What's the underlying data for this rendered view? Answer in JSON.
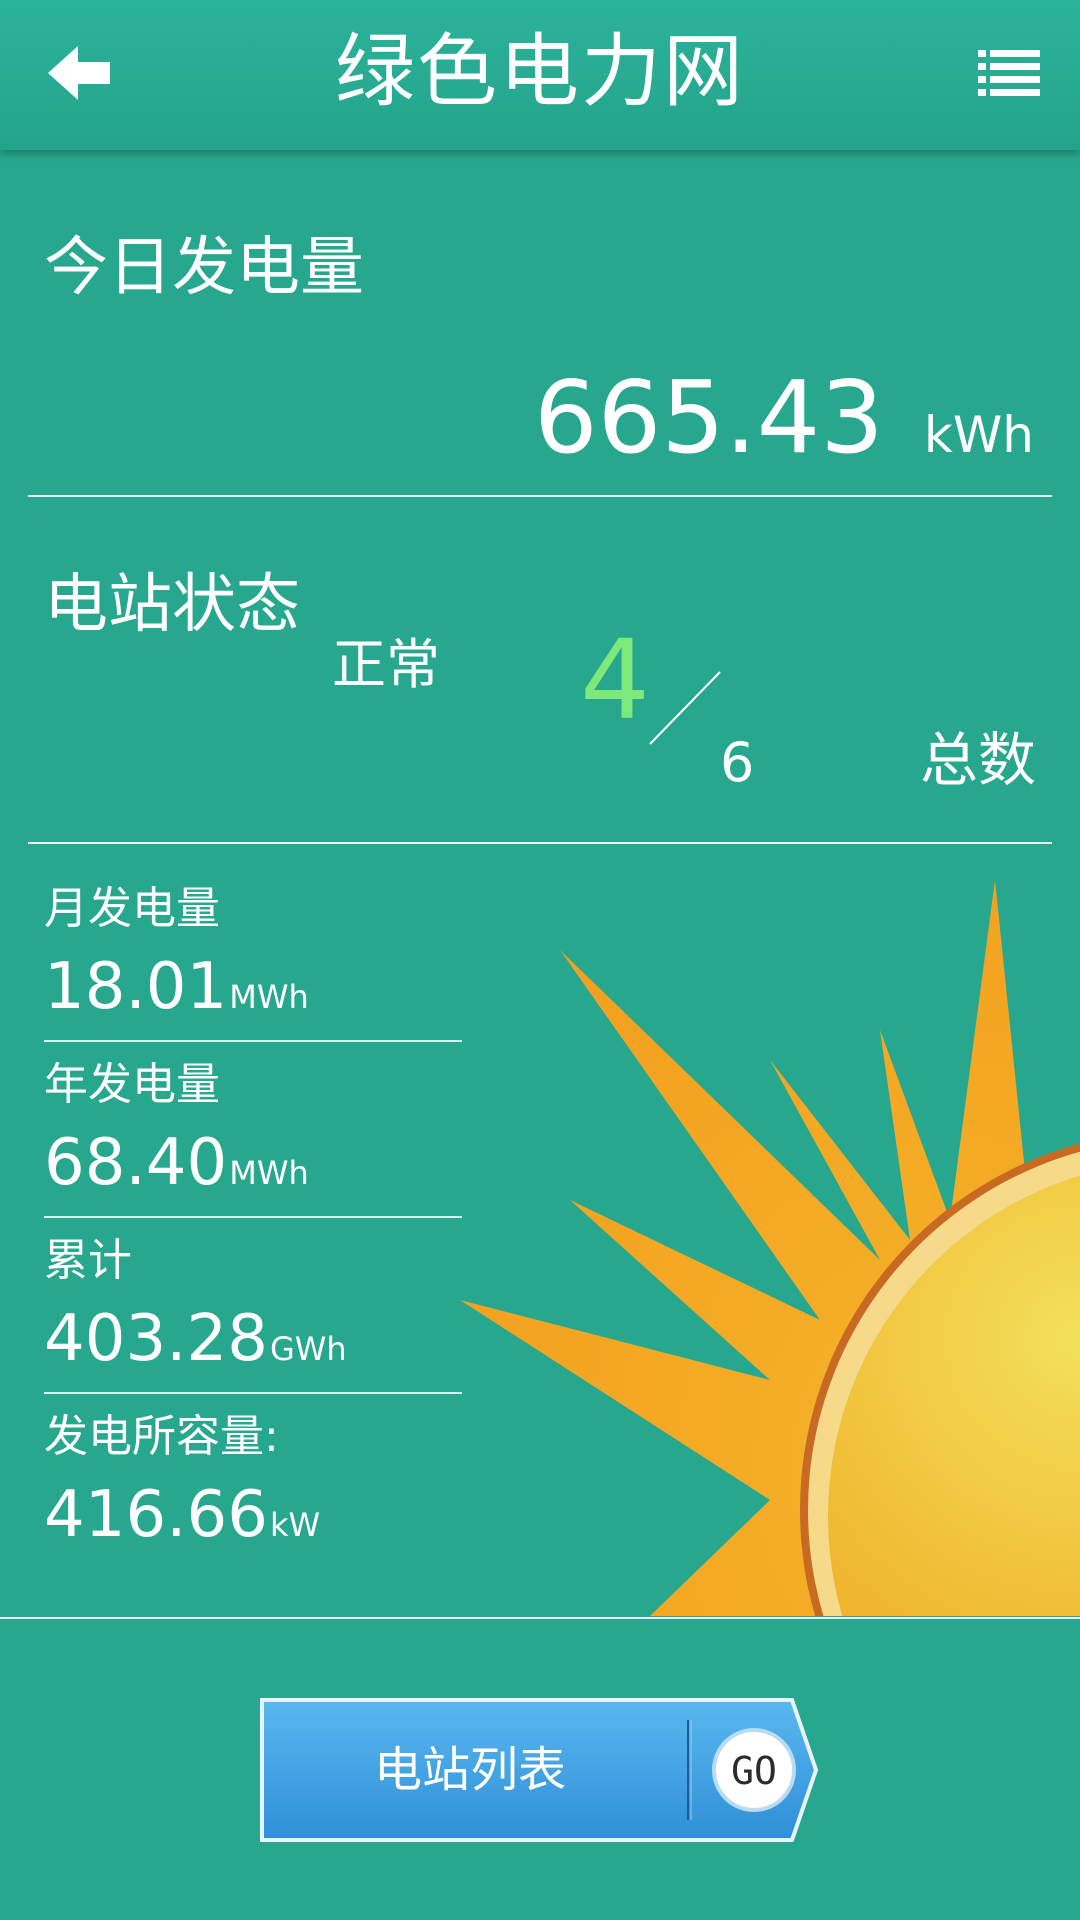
{
  "header": {
    "title": "绿色电力网"
  },
  "today": {
    "label": "今日发电量",
    "value": "665.43",
    "unit": "kWh"
  },
  "station_status": {
    "label": "电站状态",
    "normal_label": "正常",
    "normal_count": "4",
    "total_count": "6",
    "total_label": "总数"
  },
  "stats": [
    {
      "label": "月发电量",
      "value": "18.01",
      "unit": "MWh"
    },
    {
      "label": "年发电量",
      "value": "68.40",
      "unit": "MWh"
    },
    {
      "label": "累计",
      "value": "403.28",
      "unit": "GWh"
    },
    {
      "label": "发电所容量:",
      "value": "416.66",
      "unit": "kW"
    }
  ],
  "list_button": {
    "label": "电站列表",
    "go": "GO"
  },
  "colors": {
    "background": "#27a88e",
    "normal_count": "#7ee87a",
    "button": "#3d9fe0",
    "sun_rays": "#f4a823",
    "sun_core": "#f0c430"
  },
  "icons": {
    "back": "back-arrow-icon",
    "menu": "list-menu-icon",
    "go": "go-icon",
    "sun": "sun-illustration"
  }
}
